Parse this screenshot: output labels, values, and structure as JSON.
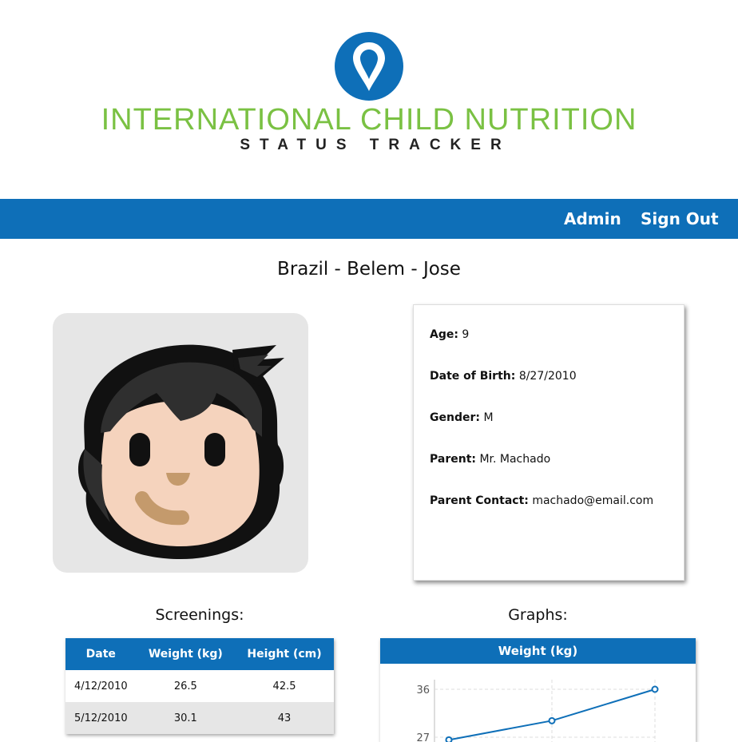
{
  "header": {
    "logo_title": "INTERNATIONAL CHILD NUTRITION",
    "logo_subtitle": "STATUS TRACKER",
    "brand_blue": "#0e6fb8",
    "brand_green": "#7ac143"
  },
  "nav": {
    "admin": "Admin",
    "sign_out": "Sign Out"
  },
  "page": {
    "title": "Brazil - Belem - Jose"
  },
  "avatar": {
    "icon": "child-face-icon"
  },
  "info": {
    "age_label": "Age:",
    "age_value": "9",
    "dob_label": "Date of Birth:",
    "dob_value": "8/27/2010",
    "gender_label": "Gender:",
    "gender_value": "M",
    "parent_label": "Parent:",
    "parent_value": "Mr. Machado",
    "contact_label": "Parent Contact:",
    "contact_value": "machado@email.com"
  },
  "screenings": {
    "title": "Screenings:",
    "headers": [
      "Date",
      "Weight (kg)",
      "Height (cm)"
    ],
    "rows": [
      [
        "4/12/2010",
        "26.5",
        "42.5"
      ],
      [
        "5/12/2010",
        "30.1",
        "43"
      ]
    ]
  },
  "graphs": {
    "title": "Graphs:",
    "weight_title": "Weight (kg)"
  },
  "chart_data": {
    "type": "line",
    "title": "Weight (kg)",
    "y_tick_labels": [
      "36",
      "27"
    ],
    "series": [
      {
        "values": [
          26.5,
          30.1,
          36
        ]
      }
    ]
  }
}
